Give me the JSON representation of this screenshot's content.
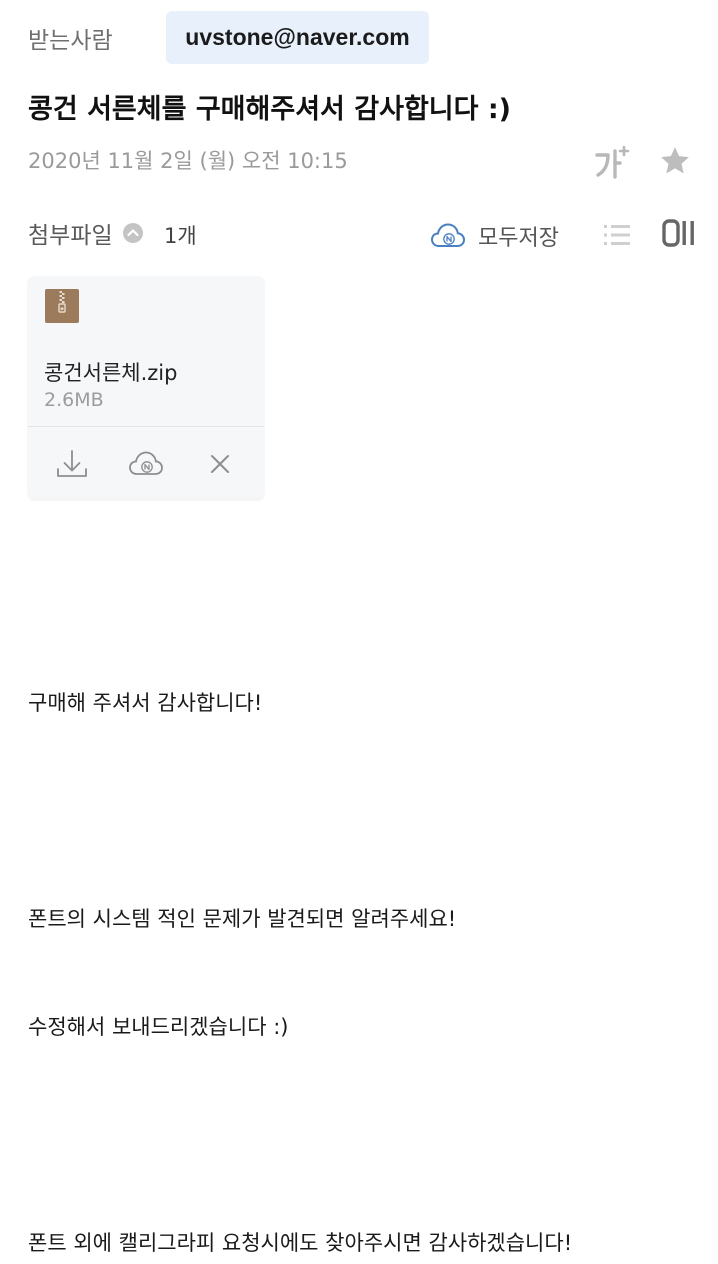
{
  "recipient": {
    "label": "받는사람",
    "email": "uvstone@naver.com"
  },
  "subject": "콩건 서른체를 구매해주셔서 감사합니다 :)",
  "date": "2020년 11월 2일 (월) 오전 10:15",
  "toolbar": {
    "font_size_icon": "font-size-plus-icon",
    "star_icon": "star-icon"
  },
  "attachments": {
    "label": "첨부파일",
    "count": "1개",
    "save_all_label": "모두저장",
    "files": [
      {
        "name": "콩건서른체.zip",
        "size": "2.6MB",
        "icon": "zip-file-icon"
      }
    ]
  },
  "body": {
    "lines": [
      "구매해 주셔서 감사합니다!",
      "폰트의 시스템 적인 문제가 발견되면 알려주세요!",
      "수정해서 보내드리겠습니다 :)",
      "폰트 외에 캘리그라피 요청시에도 찾아주시면 감사하겠습니다!"
    ]
  },
  "colors": {
    "chip_background": "#e8f0fb",
    "cloud_blue": "#4a7fc1",
    "zip_brown": "#9b7b5c"
  }
}
